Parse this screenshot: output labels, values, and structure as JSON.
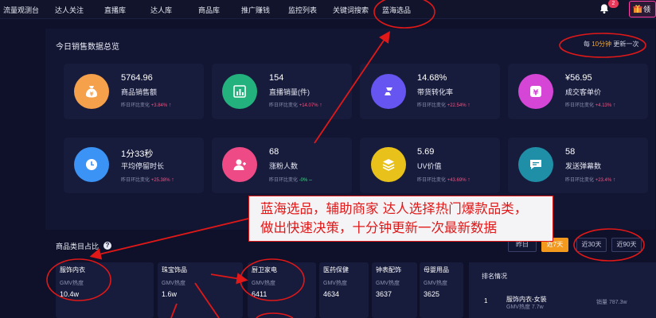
{
  "nav": {
    "items": [
      "流量观测台",
      "达人关注",
      "直播库",
      "达人库",
      "商品库",
      "推广赚钱",
      "监控列表",
      "关键词搜索",
      "蓝海选品"
    ],
    "badge": "2",
    "gift_label": "领"
  },
  "overview": {
    "title": "今日销售数据总览",
    "refresh_prefix": "每 ",
    "refresh_value": "10分钟",
    "refresh_suffix": " 更新一次",
    "change_label": "昨日环比变化",
    "cards": [
      {
        "icon": "money-bag-icon",
        "color": "#f5a04a",
        "value": "5764.96",
        "label": "商品销售额",
        "change": "+3.84%"
      },
      {
        "icon": "bar-chart-icon",
        "color": "#23b27d",
        "value": "154",
        "label": "直播销量(件)",
        "change": "+14.07%"
      },
      {
        "icon": "conversion-icon",
        "color": "#6655f0",
        "value": "14.68%",
        "label": "带货转化率",
        "change": "+22.54%"
      },
      {
        "icon": "yen-icon",
        "color": "#d646d6",
        "value": "¥56.95",
        "label": "成交客单价",
        "change": "+4.13%"
      },
      {
        "icon": "clock-icon",
        "color": "#3b93f5",
        "value": "1分33秒",
        "label": "平均停留时长",
        "change": "+25.38%"
      },
      {
        "icon": "user-icon",
        "color": "#ee4b86",
        "value": "68",
        "label": "涨粉人数",
        "change": "-0%"
      },
      {
        "icon": "layers-icon",
        "color": "#e8c21b",
        "value": "5.69",
        "label": "UV价值",
        "change": "+43.69%"
      },
      {
        "icon": "chat-icon",
        "color": "#1f8fa8",
        "value": "58",
        "label": "发送弹幕数",
        "change": "+23.4%"
      }
    ]
  },
  "banner": {
    "line1": "蓝海选品，辅助商家 达人选择热门爆款品类，",
    "line2": "做出快速决策，十分钟更新一次最新数据"
  },
  "categories": {
    "title": "商品类目占比",
    "help": "?",
    "ranges": [
      "昨日",
      "近7天",
      "近30天",
      "近90天"
    ],
    "active_range": "近7天",
    "gmv_label": "GMV热度",
    "items": [
      {
        "name": "服饰内衣",
        "value": "10.4w"
      },
      {
        "name": "珠宝饰品",
        "value": "1.6w"
      },
      {
        "name": "厨卫家电",
        "value": "6411"
      },
      {
        "name": "医药保健",
        "value": "4634"
      },
      {
        "name": "钟表配饰",
        "value": "3637"
      },
      {
        "name": "母婴用品",
        "value": "3625"
      }
    ]
  },
  "ranking": {
    "title": "排名情况",
    "rank": "1",
    "name": "服饰内衣-女装",
    "sub_label": "GMV热度",
    "sub_value": "7.7w",
    "sales_label": "销量",
    "sales_value": "787.3w"
  },
  "colors": {
    "accent": "#f39a1e",
    "annotation": "#e01818",
    "positive": "#ff4d7d",
    "zero": "#3fd68a"
  }
}
